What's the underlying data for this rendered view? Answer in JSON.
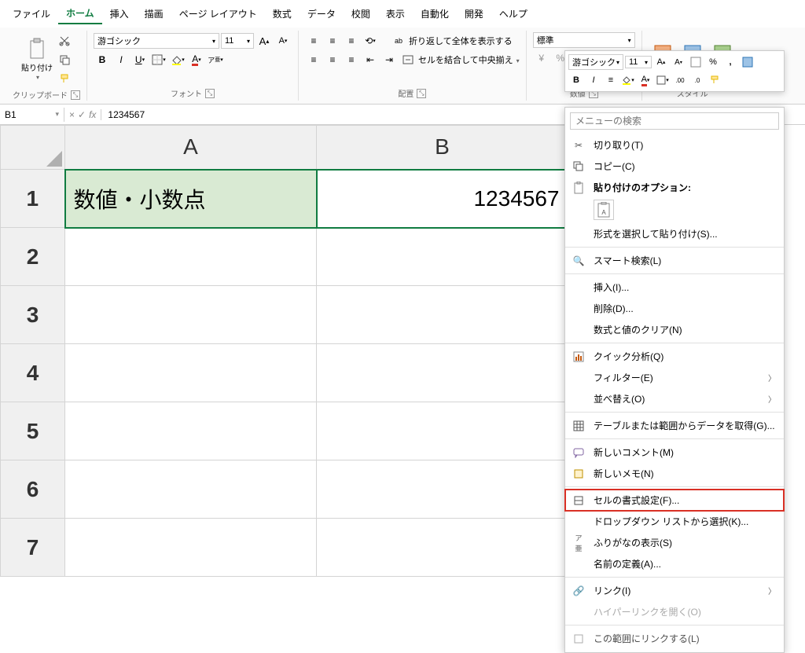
{
  "menubar": [
    "ファイル",
    "ホーム",
    "挿入",
    "描画",
    "ページ レイアウト",
    "数式",
    "データ",
    "校閲",
    "表示",
    "自動化",
    "開発",
    "ヘルプ"
  ],
  "menubar_active_index": 1,
  "ribbon": {
    "clipboard": {
      "paste": "貼り付け",
      "label": "クリップボード"
    },
    "font": {
      "font_name": "游ゴシック",
      "font_size": "11",
      "label": "フォント"
    },
    "alignment": {
      "wrap": "折り返して全体を表示する",
      "merge": "セルを結合して中央揃え",
      "label": "配置"
    },
    "number": {
      "format": "標準",
      "label": "数値"
    },
    "style": {
      "label": "スタイル"
    }
  },
  "name_box": "B1",
  "formula_value": "1234567",
  "columns": [
    "A",
    "B"
  ],
  "rows": [
    "1",
    "2",
    "3",
    "4",
    "5",
    "6",
    "7"
  ],
  "cells": {
    "A1": "数値・小数点",
    "B1": "1234567"
  },
  "mini_toolbar": {
    "font_name": "游ゴシック",
    "font_size": "11"
  },
  "context_menu": {
    "search_placeholder": "メニューの検索",
    "items": [
      {
        "icon": "scissors",
        "label": "切り取り(T)"
      },
      {
        "icon": "copy",
        "label": "コピー(C)"
      },
      {
        "icon": "paste",
        "label": "貼り付けのオプション:",
        "is_header": true
      },
      {
        "icon": "",
        "label": "形式を選択して貼り付け(S)...",
        "indent": true
      },
      {
        "icon": "search",
        "label": "スマート検索(L)",
        "sep_before": true
      },
      {
        "icon": "",
        "label": "挿入(I)...",
        "sep_before": true
      },
      {
        "icon": "",
        "label": "削除(D)..."
      },
      {
        "icon": "",
        "label": "数式と値のクリア(N)"
      },
      {
        "icon": "quick",
        "label": "クイック分析(Q)",
        "sep_before": true
      },
      {
        "icon": "",
        "label": "フィルター(E)",
        "submenu": true
      },
      {
        "icon": "",
        "label": "並べ替え(O)",
        "submenu": true
      },
      {
        "icon": "table",
        "label": "テーブルまたは範囲からデータを取得(G)...",
        "sep_before": true
      },
      {
        "icon": "comment",
        "label": "新しいコメント(M)",
        "sep_before": true
      },
      {
        "icon": "note",
        "label": "新しいメモ(N)"
      },
      {
        "icon": "format",
        "label": "セルの書式設定(F)...",
        "highlight": true,
        "sep_before": true
      },
      {
        "icon": "",
        "label": "ドロップダウン リストから選択(K)..."
      },
      {
        "icon": "furigana",
        "label": "ふりがなの表示(S)"
      },
      {
        "icon": "",
        "label": "名前の定義(A)..."
      },
      {
        "icon": "link",
        "label": "リンク(I)",
        "submenu": true,
        "sep_before": true
      },
      {
        "icon": "",
        "label": "ハイパーリンクを開く(O)",
        "disabled": true
      },
      {
        "icon": "",
        "label": "この範囲にリンクする(L)",
        "cut_off": true
      }
    ]
  }
}
